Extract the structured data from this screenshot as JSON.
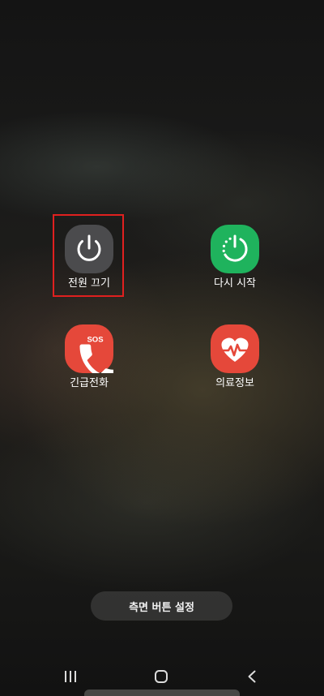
{
  "power_menu": {
    "highlight_color": "#e0201f",
    "items": [
      {
        "id": "power-off",
        "label": "전원 끄기",
        "icon": "power-icon",
        "color": "#4b4b4d",
        "highlighted": true
      },
      {
        "id": "restart",
        "label": "다시 시작",
        "icon": "restart-icon",
        "color": "#1fb35d",
        "highlighted": false
      },
      {
        "id": "emergency-call",
        "label": "긴급전화",
        "icon": "sos-phone-icon",
        "badge": "SOS",
        "color": "#e5483a",
        "highlighted": false
      },
      {
        "id": "medical-info",
        "label": "의료정보",
        "icon": "heart-pulse-icon",
        "color": "#e5483a",
        "highlighted": false
      }
    ]
  },
  "side_button_settings": {
    "label": "측면 버튼 설정"
  },
  "nav_bar": {
    "recents": "recents-icon",
    "home": "home-icon",
    "back": "back-icon"
  }
}
